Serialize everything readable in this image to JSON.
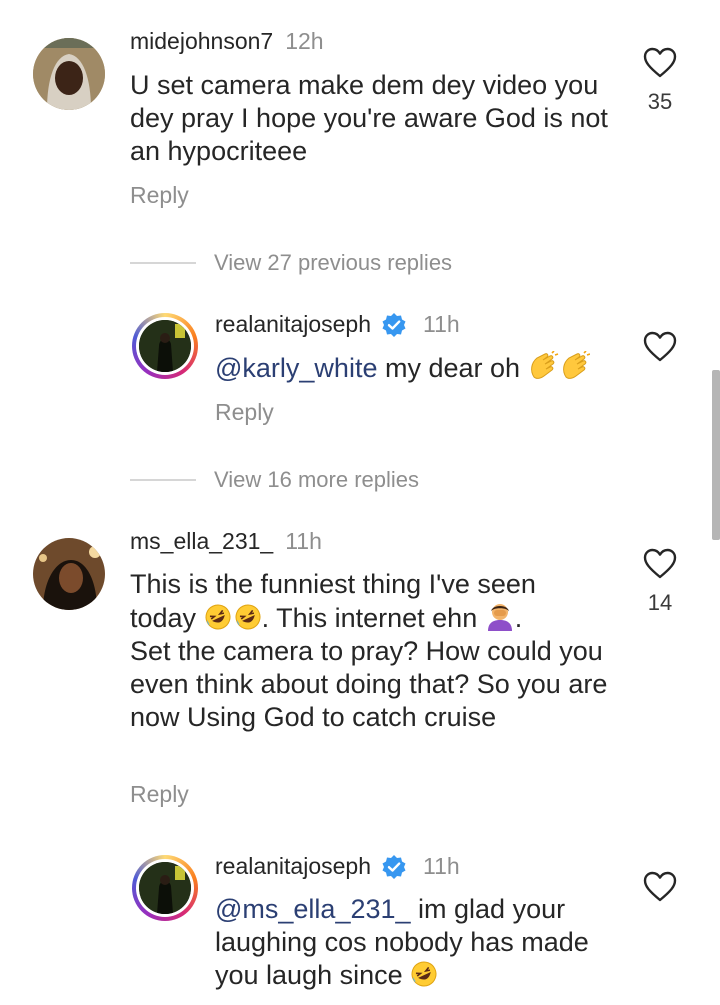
{
  "comments": [
    {
      "username": "midejohnson7",
      "time": "12h",
      "text": "U set camera make dem dey video you dey pray I hope you're aware God is not an hypocriteee",
      "reply_label": "Reply",
      "likes": "35"
    },
    {
      "username": "ms_ella_231_",
      "time": "11h",
      "text_line1": "This is the funniest thing I've seen",
      "text_line2a": "today",
      "text_line2b": ". This internet ehn",
      "text_rest": "Set the camera to pray? How could you even think about doing that? So you are now Using God to catch cruise",
      "reply_label": "Reply",
      "likes": "14"
    }
  ],
  "replies": [
    {
      "username": "realanitajoseph",
      "time": "11h",
      "mention": "@karly_white",
      "text": " my dear oh",
      "reply_label": "Reply"
    },
    {
      "username": "realanitajoseph",
      "time": "11h",
      "mention": "@ms_ella_231_",
      "text": " im glad your laughing cos nobody has made you laugh since"
    }
  ],
  "view_more": [
    {
      "label": "View 27 previous replies"
    },
    {
      "label": "View 16 more replies"
    }
  ],
  "icons": {
    "heart": "heart-icon",
    "verified": "verified-badge-icon",
    "clap": "clapping-hands-emoji",
    "laugh": "rolling-on-floor-laughing-emoji",
    "facepalm": "woman-facepalming-emoji"
  },
  "colors": {
    "text": "#262626",
    "secondary": "#8e8e8e",
    "mention": "#2b3f73",
    "verified": "#3797f0"
  }
}
